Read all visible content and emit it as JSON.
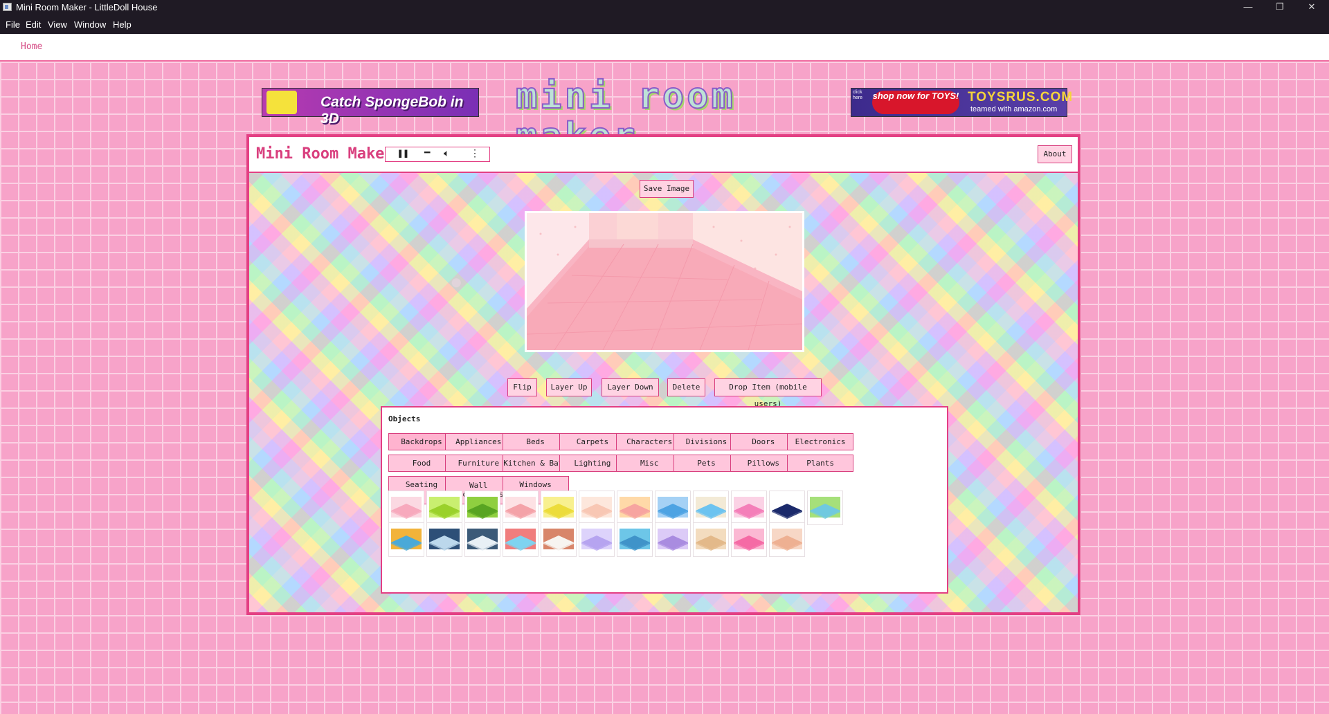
{
  "window": {
    "title": "Mini Room Maker - LittleDoll House",
    "controls": {
      "minimize": "—",
      "restore": "❐",
      "close": "✕"
    }
  },
  "menu": [
    "File",
    "Edit",
    "View",
    "Window",
    "Help"
  ],
  "nav": {
    "home": "Home"
  },
  "ads": {
    "left_text": "Catch SpongeBob in 3D",
    "logo_text": "mini room maker",
    "right_click_here": "click here",
    "right_shop": "shop now for TOYS!",
    "right_brand": "TOYSRUS.COM",
    "right_teamed": "teamed with amazon.com"
  },
  "header": {
    "title": "Mini Room Maker",
    "player_icons": [
      "pause-icon",
      "minus-icon",
      "volume-icon",
      "more-vertical-icon"
    ],
    "about": "About"
  },
  "toolbar": {
    "save": "Save Image",
    "flip": "Flip",
    "layer_up": "Layer Up",
    "layer_down": "Layer Down",
    "delete": "Delete",
    "drop": "Drop Item (mobile users)"
  },
  "objects": {
    "label": "Objects",
    "categories": [
      "Backdrops",
      "Appliances",
      "Beds",
      "Carpets",
      "Characters",
      "Divisions",
      "Doors",
      "Electronics",
      "Food",
      "Furniture",
      "Kitchen & Bath",
      "Lighting",
      "Misc",
      "Pets",
      "Pillows",
      "Plants",
      "Seating",
      "Wall\nDecorations",
      "Windows"
    ],
    "selected_category": "Backdrops",
    "thumbnails": [
      {
        "name": "pink-room",
        "floor": "#f7a9bd",
        "wall": "#fbd9e2"
      },
      {
        "name": "grass-lime",
        "floor": "#9ad12b",
        "wall": "#c9ef70"
      },
      {
        "name": "grass-green",
        "floor": "#58a422",
        "wall": "#8fcf40"
      },
      {
        "name": "pink-pond",
        "floor": "#f4a2a8",
        "wall": "#fde1e4"
      },
      {
        "name": "yellow-field",
        "floor": "#ecdc3a",
        "wall": "#f8f08f"
      },
      {
        "name": "peach-room",
        "floor": "#f8c7b4",
        "wall": "#fde7dc"
      },
      {
        "name": "candy-room",
        "floor": "#f7a4a0",
        "wall": "#ffd9a8"
      },
      {
        "name": "blue-pool",
        "floor": "#4da3e3",
        "wall": "#a5d1f5"
      },
      {
        "name": "beach",
        "floor": "#6cc3f0",
        "wall": "#f3ead6"
      },
      {
        "name": "pink-tile",
        "floor": "#f47fb9",
        "wall": "#fbd2e5"
      },
      {
        "name": "night-sky",
        "floor": "#1b2a6b",
        "wall": "#ffffff"
      },
      {
        "name": "island",
        "floor": "#6fc9e0",
        "wall": "#a6e07a"
      },
      {
        "name": "sunset-beach",
        "floor": "#4aa9d8",
        "wall": "#f2b33a"
      },
      {
        "name": "ice",
        "floor": "#bcd8ec",
        "wall": "#2d4f77"
      },
      {
        "name": "snow-hills",
        "floor": "#e8f0f5",
        "wall": "#3b5a78"
      },
      {
        "name": "rainbow",
        "floor": "#7ed3f0",
        "wall": "#f07d7d"
      },
      {
        "name": "kitchen",
        "floor": "#f7f4f0",
        "wall": "#d8856a"
      },
      {
        "name": "lavender",
        "floor": "#b6a4f0",
        "wall": "#ddd3fb"
      },
      {
        "name": "blue-stripes",
        "floor": "#3f93c9",
        "wall": "#6dc6e8"
      },
      {
        "name": "purple-dots",
        "floor": "#a98ce0",
        "wall": "#dccbf7"
      },
      {
        "name": "tan-room",
        "floor": "#e3b98a",
        "wall": "#f3dcbf"
      },
      {
        "name": "hot-pink",
        "floor": "#f56aa5",
        "wall": "#fbb8d3"
      },
      {
        "name": "salmon",
        "floor": "#eeb092",
        "wall": "#f7d7c6"
      }
    ]
  },
  "colors": {
    "accent": "#e33f83",
    "button_bg": "#ffd3e3",
    "brick": "#f7a3c9"
  }
}
